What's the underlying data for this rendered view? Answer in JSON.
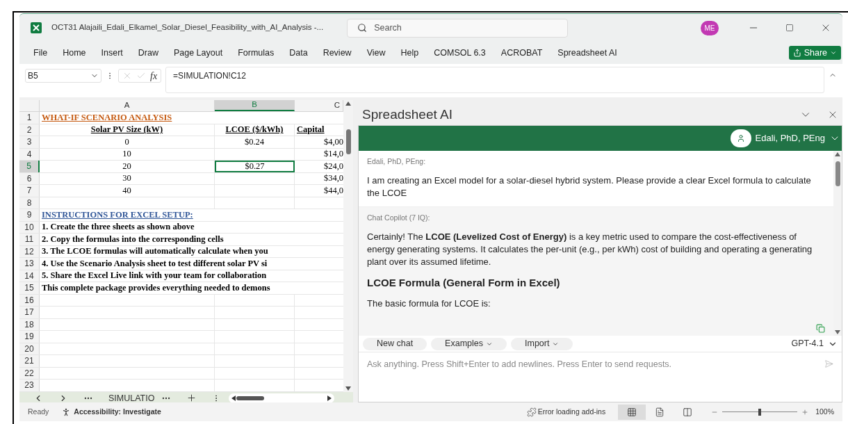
{
  "window": {
    "title": "OCT31 Alajaili_Edali_Elkamel_Solar_Diesel_Feasibility_with_AI_Analysis  -...",
    "search_placeholder": "Search",
    "avatar": "ME"
  },
  "menu": [
    "File",
    "Home",
    "Insert",
    "Draw",
    "Page Layout",
    "Formulas",
    "Data",
    "Review",
    "View",
    "Help",
    "COMSOL 6.3",
    "ACROBAT",
    "Spreadsheet AI"
  ],
  "share": "Share",
  "formula_bar": {
    "name_box": "B5",
    "function_label": "fx",
    "formula": "=SIMULATION!C12"
  },
  "sheet": {
    "columns": [
      {
        "label": "A",
        "selected": false
      },
      {
        "label": "B",
        "selected": true
      },
      {
        "label": "C",
        "selected": false
      }
    ],
    "rows": [
      {
        "number": "1",
        "kind": "title",
        "selected": false,
        "a": "WHAT-IF SCENARIO ANALYSIS"
      },
      {
        "number": "2",
        "kind": "header",
        "selected": false,
        "a": "Solar PV Size (kW)",
        "b": "LCOE ($/kWh)",
        "c": "Capital"
      },
      {
        "number": "3",
        "kind": "value",
        "selected": false,
        "a": "0",
        "b": "$0.24",
        "c": "$4,00"
      },
      {
        "number": "4",
        "kind": "value",
        "selected": false,
        "a": "10",
        "c": "$14,0"
      },
      {
        "number": "5",
        "kind": "value",
        "selected": true,
        "a": "20",
        "b": "$0.27",
        "c": "$24,0"
      },
      {
        "number": "6",
        "kind": "value",
        "selected": false,
        "a": "30",
        "c": "$34,0"
      },
      {
        "number": "7",
        "kind": "value",
        "selected": false,
        "a": "40",
        "c": "$44,0"
      },
      {
        "number": "8",
        "kind": "blank",
        "selected": false
      },
      {
        "number": "9",
        "kind": "section",
        "selected": false,
        "a": "INSTRUCTIONS FOR EXCEL SETUP:"
      },
      {
        "number": "10",
        "kind": "note",
        "selected": false,
        "a": "1. Create the three sheets as shown above"
      },
      {
        "number": "11",
        "kind": "note",
        "selected": false,
        "a": "2. Copy the formulas into the corresponding cells"
      },
      {
        "number": "12",
        "kind": "note",
        "selected": false,
        "a": "3. The LCOE formulas will automatically calculate when you"
      },
      {
        "number": "13",
        "kind": "note",
        "selected": false,
        "a": "4. Use the Scenario Analysis sheet to test different solar PV si"
      },
      {
        "number": "14",
        "kind": "note",
        "selected": false,
        "a": "5. Share the Excel Live link with your team for collaboration"
      },
      {
        "number": "15",
        "kind": "note",
        "selected": false,
        "a": "This complete package provides everything needed to demons"
      },
      {
        "number": "16",
        "kind": "blank",
        "selected": false
      },
      {
        "number": "17",
        "kind": "blank",
        "selected": false
      },
      {
        "number": "18",
        "kind": "blank",
        "selected": false
      },
      {
        "number": "19",
        "kind": "blank",
        "selected": false
      },
      {
        "number": "20",
        "kind": "blank",
        "selected": false
      },
      {
        "number": "21",
        "kind": "blank",
        "selected": false
      },
      {
        "number": "22",
        "kind": "blank",
        "selected": false
      },
      {
        "number": "23",
        "kind": "blank",
        "selected": false
      }
    ],
    "sheet_tab": "SIMULATIO"
  },
  "panel": {
    "title": "Spreadsheet AI",
    "user": "Edali, PhD, PEng",
    "messages": [
      {
        "kind": "user",
        "sender": "Edali, PhD, PEng:",
        "blocks": [
          {
            "kind": "paragraph",
            "text": "I am creating an Excel model for a solar-diesel hybrid system. Please provide a clear Excel formula to calculate the LCOE"
          }
        ]
      },
      {
        "kind": "assistant",
        "sender": "Chat Copilot (7 IQ):",
        "blocks": [
          {
            "kind": "paragraph",
            "text": "Certainly! The **LCOE (Levelized Cost of Energy)** is a key metric used to compare the cost-effectiveness of energy generating systems. It calculates the per-unit (e.g., per kWh) cost of building and operating a generating plant over its assumed lifetime."
          },
          {
            "kind": "heading",
            "text": "LCOE Formula (General Form in Excel)"
          },
          {
            "kind": "paragraph",
            "text": "The basic formula for LCOE is:"
          }
        ]
      }
    ],
    "actions": [
      {
        "label": "New chat",
        "dropdown": false
      },
      {
        "label": "Examples",
        "dropdown": true
      },
      {
        "label": "Import",
        "dropdown": true
      }
    ],
    "model": "GPT-4.1",
    "input_placeholder": "Ask anything. Press Shift+Enter to add newlines. Press Enter to send requests."
  },
  "status": {
    "ready": "Ready",
    "accessibility": "Accessibility: Investigate",
    "addins": "Error loading add-ins",
    "views": [
      {
        "kind": "normal",
        "selected": true
      },
      {
        "kind": "page_layout",
        "selected": false
      },
      {
        "kind": "page_break",
        "selected": false
      }
    ],
    "zoom": {
      "level": 0.5,
      "reading": "100%"
    }
  }
}
